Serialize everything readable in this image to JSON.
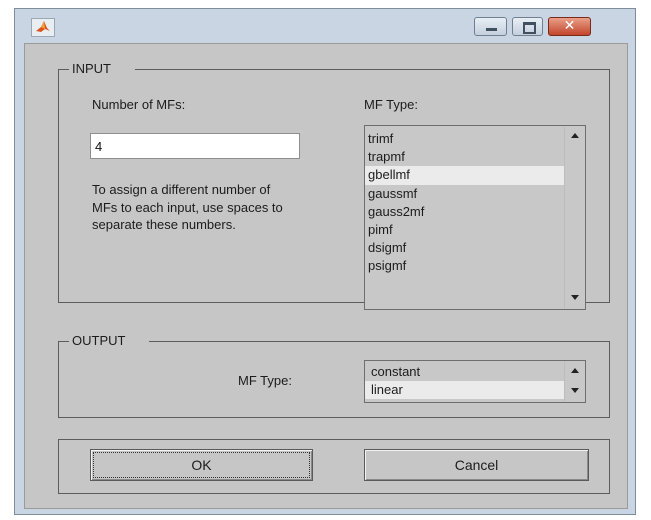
{
  "window": {
    "app_icon": "matlab-icon",
    "controls": {
      "minimize": "minimize-icon",
      "maximize": "maximize-icon",
      "close": "close-icon"
    }
  },
  "input": {
    "group_label": "INPUT",
    "num_mfs_label": "Number of MFs:",
    "num_mfs_value": "4",
    "help_text": "To assign a different number of MFs to each input, use spaces to separate these numbers.",
    "mf_type_label": "MF Type:",
    "mf_types": [
      "trimf",
      "trapmf",
      "gbellmf",
      "gaussmf",
      "gauss2mf",
      "pimf",
      "dsigmf",
      "psigmf"
    ],
    "selected": "gbellmf"
  },
  "output": {
    "group_label": "OUTPUT",
    "mf_type_label": "MF Type:",
    "mf_types": [
      "constant",
      "linear"
    ],
    "selected": "linear"
  },
  "buttons": {
    "ok": "OK",
    "cancel": "Cancel"
  },
  "colors": {
    "panel": "#c6c6c6",
    "selection": "#ebebeb",
    "frame": "#c9d5e2",
    "close_button": "#c2452b"
  }
}
